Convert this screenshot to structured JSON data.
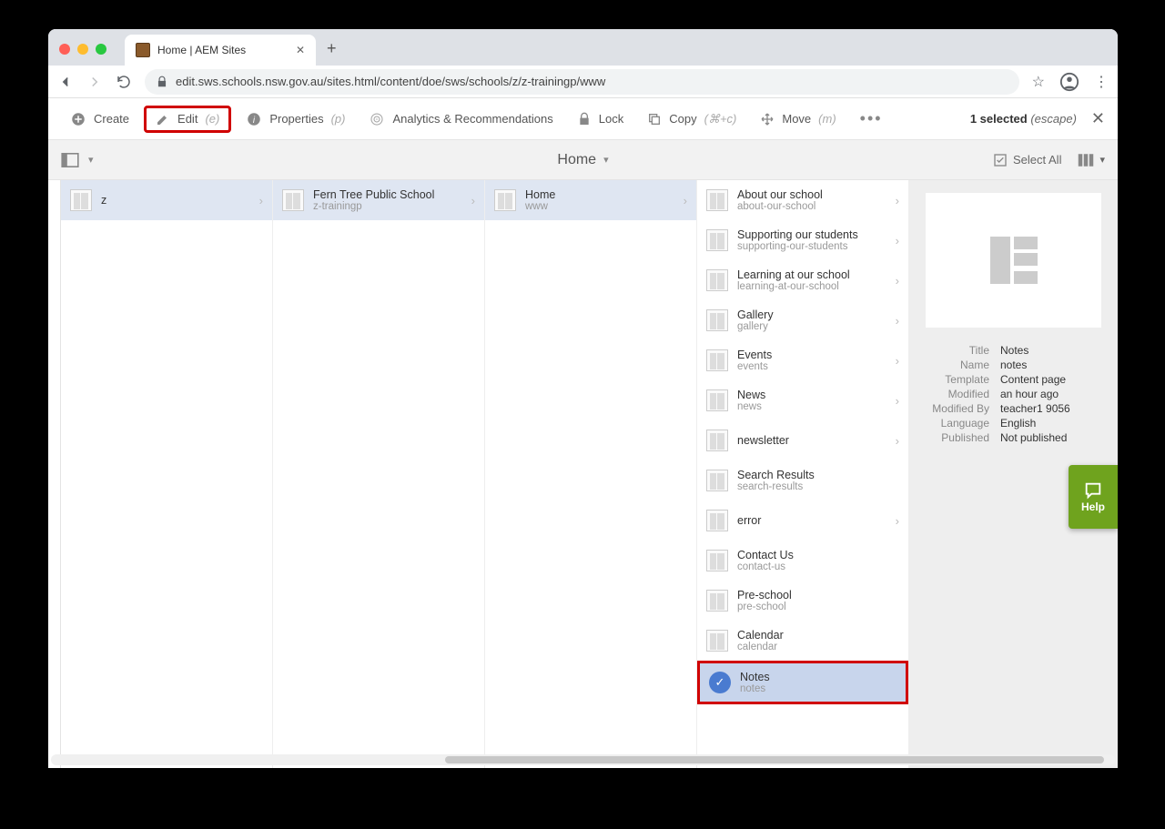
{
  "browser": {
    "tab_title": "Home | AEM Sites",
    "url": "edit.sws.schools.nsw.gov.au/sites.html/content/doe/sws/schools/z/z-trainingp/www"
  },
  "toolbar": {
    "create": "Create",
    "edit": "Edit",
    "edit_sc": "(e)",
    "properties": "Properties",
    "properties_sc": "(p)",
    "analytics": "Analytics & Recommendations",
    "lock": "Lock",
    "copy": "Copy",
    "copy_sc": "(⌘+c)",
    "move": "Move",
    "move_sc": "(m)",
    "selected_count": "1 selected",
    "escape": "(escape)"
  },
  "subbar": {
    "title": "Home",
    "select_all": "Select All"
  },
  "columns": [
    {
      "items": [
        {
          "title": "z",
          "sub": "",
          "arrow": true
        }
      ]
    },
    {
      "items": [
        {
          "title": "Fern Tree Public School",
          "sub": "z-trainingp",
          "arrow": true
        }
      ]
    },
    {
      "items": [
        {
          "title": "Home",
          "sub": "www",
          "arrow": true
        }
      ]
    },
    {
      "items": [
        {
          "title": "About our school",
          "sub": "about-our-school",
          "arrow": true
        },
        {
          "title": "Supporting our students",
          "sub": "supporting-our-students",
          "arrow": true
        },
        {
          "title": "Learning at our school",
          "sub": "learning-at-our-school",
          "arrow": true
        },
        {
          "title": "Gallery",
          "sub": "gallery",
          "arrow": true
        },
        {
          "title": "Events",
          "sub": "events",
          "arrow": true
        },
        {
          "title": "News",
          "sub": "news",
          "arrow": true
        },
        {
          "title": "newsletter",
          "sub": "",
          "arrow": true
        },
        {
          "title": "Search Results",
          "sub": "search-results",
          "arrow": false
        },
        {
          "title": "error",
          "sub": "",
          "arrow": true
        },
        {
          "title": "Contact Us",
          "sub": "contact-us",
          "arrow": false
        },
        {
          "title": "Pre-school",
          "sub": "pre-school",
          "arrow": false
        },
        {
          "title": "Calendar",
          "sub": "calendar",
          "arrow": false
        },
        {
          "title": "Notes",
          "sub": "notes",
          "arrow": false,
          "selected": true
        }
      ]
    }
  ],
  "detail": {
    "props": [
      {
        "label": "Title",
        "value": "Notes"
      },
      {
        "label": "Name",
        "value": "notes"
      },
      {
        "label": "Template",
        "value": "Content page"
      },
      {
        "label": "Modified",
        "value": "an hour ago"
      },
      {
        "label": "Modified By",
        "value": "teacher1 9056"
      },
      {
        "label": "Language",
        "value": "English"
      },
      {
        "label": "Published",
        "value": "Not published"
      }
    ]
  },
  "help": "Help"
}
